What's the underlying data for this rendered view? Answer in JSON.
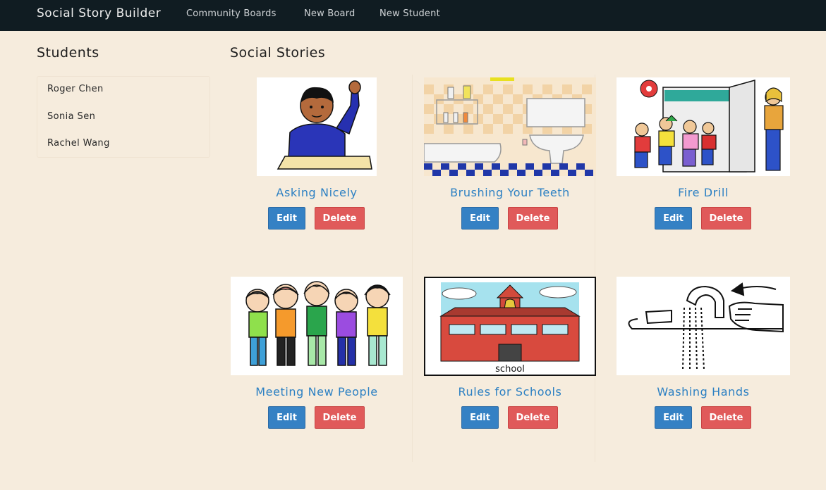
{
  "navbar": {
    "brand": "Social Story Builder",
    "links": [
      "Community Boards",
      "New Board",
      "New Student"
    ]
  },
  "sidebar": {
    "title": "Students",
    "students": [
      "Roger Chen",
      "Sonia Sen",
      "Rachel Wang"
    ]
  },
  "main": {
    "title": "Social Stories",
    "stories": [
      {
        "title": "Asking Nicely",
        "edit": "Edit",
        "delete": "Delete",
        "icon": "student-raising-hand-icon"
      },
      {
        "title": "Brushing Your Teeth",
        "edit": "Edit",
        "delete": "Delete",
        "icon": "bathroom-icon"
      },
      {
        "title": "Fire Drill",
        "edit": "Edit",
        "delete": "Delete",
        "icon": "fire-drill-icon"
      },
      {
        "title": "Meeting New People",
        "edit": "Edit",
        "delete": "Delete",
        "icon": "group-of-friends-icon"
      },
      {
        "title": "Rules for Schools",
        "edit": "Edit",
        "delete": "Delete",
        "icon": "school-building-icon",
        "image_caption": "school"
      },
      {
        "title": "Washing Hands",
        "edit": "Edit",
        "delete": "Delete",
        "icon": "hand-washing-icon"
      }
    ]
  },
  "colors": {
    "background": "#f6ecdd",
    "navbar": "#101c22",
    "link": "#2c80c3",
    "edit_button": "#3581c4",
    "delete_button": "#e05a5a"
  }
}
